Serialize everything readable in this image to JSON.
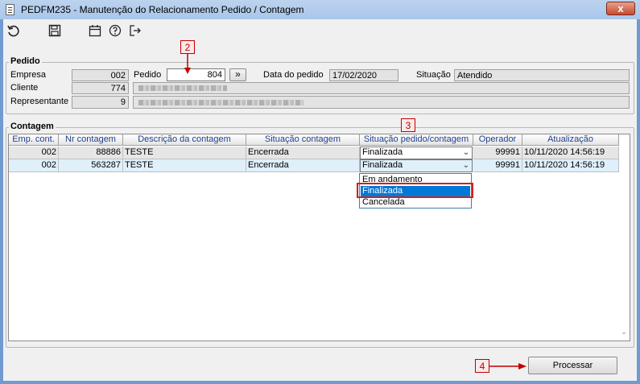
{
  "window": {
    "title": "PEDFM235 - Manutenção do Relacionamento Pedido / Contagem",
    "close_label": "x"
  },
  "toolbar": {
    "icons": [
      "undo-icon",
      "save-icon",
      "calendar-icon",
      "help-icon",
      "exit-icon"
    ]
  },
  "pedido": {
    "group_label": "Pedido",
    "empresa_label": "Empresa",
    "empresa_value": "002",
    "pedido_label": "Pedido",
    "pedido_value": "804",
    "lookup_button": "»",
    "data_label": "Data do pedido",
    "data_value": "17/02/2020",
    "situacao_label": "Situação",
    "situacao_value": "Atendido",
    "cliente_label": "Cliente",
    "cliente_value": "774",
    "representante_label": "Representante",
    "representante_value": "9"
  },
  "contagem": {
    "group_label": "Contagem",
    "columns": [
      "Emp. cont.",
      "Nr contagem",
      "Descrição da contagem",
      "Situação contagem",
      "Situação pedido/contagem",
      "Operador",
      "Atualização"
    ],
    "rows": [
      {
        "emp": "002",
        "nr": "88886",
        "descricao": "TESTE",
        "situacao": "Encerrada",
        "situacao_pedido": "Finalizada",
        "operador": "99991",
        "atualizacao": "10/11/2020 14:56:19"
      },
      {
        "emp": "002",
        "nr": "563287",
        "descricao": "TESTE",
        "situacao": "Encerrada",
        "situacao_pedido": "Finalizada",
        "operador": "99991",
        "atualizacao": "10/11/2020 14:56:19"
      }
    ],
    "dropdown_options": [
      "Em andamento",
      "Finalizada",
      "Cancelada"
    ],
    "dropdown_selected": "Finalizada"
  },
  "footer": {
    "processar_label": "Processar"
  },
  "annotations": {
    "marker_2": "2",
    "marker_3": "3",
    "marker_4": "4"
  },
  "colors": {
    "highlight": "#0078d7",
    "selected_row": "#dff0fb",
    "annotation_red": "#c00000",
    "header_text": "#1f3f8f"
  }
}
